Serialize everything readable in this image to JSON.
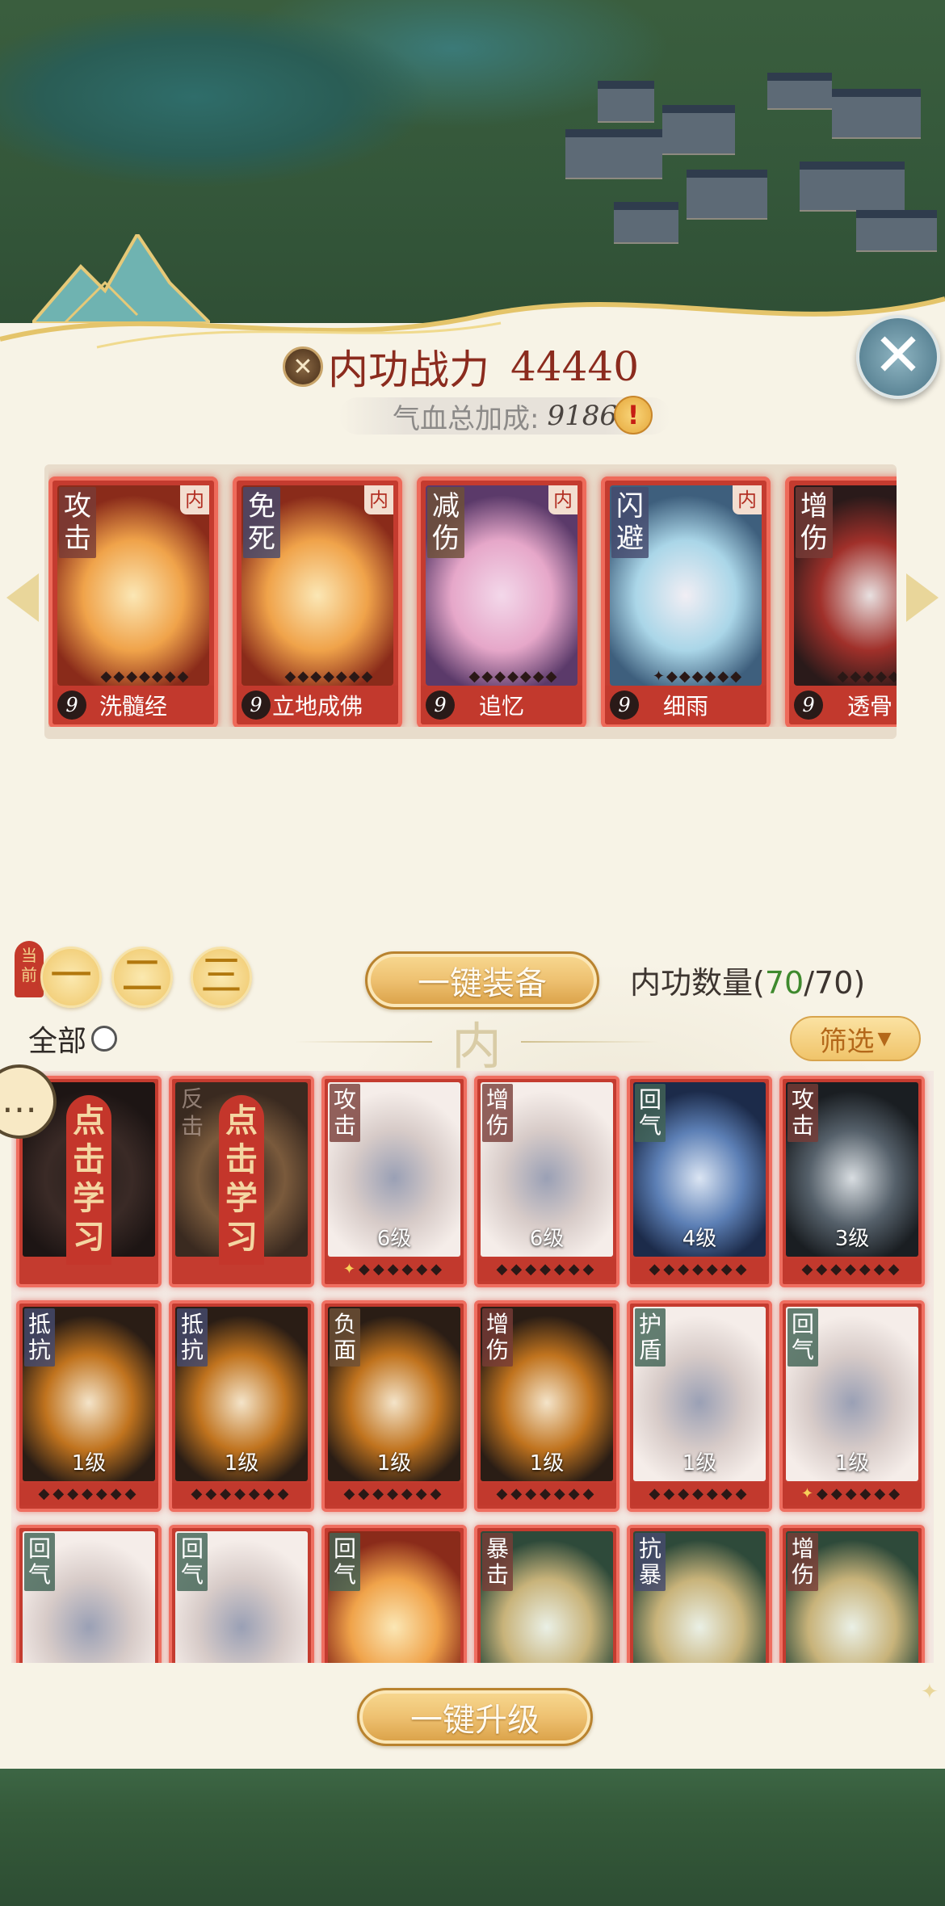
{
  "header": {
    "title_label": "内功战力",
    "power_value": "44440",
    "hp_bonus_label": "气血总加成:",
    "hp_bonus_value": "9186",
    "alert_symbol": "!",
    "close_symbol": "✕"
  },
  "equipped": [
    {
      "tag": "攻击",
      "tag_color": "red",
      "corner": "内",
      "level": "9",
      "name": "洗髓经",
      "stars": "◆◆◆◆◆◆◆",
      "art": [
        "#8a2b1a",
        "#f0a34a",
        "#fbe7b5"
      ]
    },
    {
      "tag": "免死",
      "tag_color": "blue",
      "corner": "内",
      "level": "9",
      "name": "立地成佛",
      "stars": "◆◆◆◆◆◆◆",
      "art": [
        "#8a2b1a",
        "#f0a34a",
        "#fbe7b5"
      ]
    },
    {
      "tag": "减伤",
      "tag_color": "brown",
      "corner": "内",
      "level": "9",
      "name": "追忆",
      "stars": "◆◆◆◆◆◆◆",
      "art": [
        "#5b3a6a",
        "#e6a7c9",
        "#f3d8ea"
      ]
    },
    {
      "tag": "闪避",
      "tag_color": "blue",
      "corner": "内",
      "level": "9",
      "name": "细雨",
      "stars": "✦◆◆◆◆◆◆",
      "art": [
        "#3e5f7d",
        "#aad6e8",
        "#f1eef4"
      ]
    },
    {
      "tag": "增伤",
      "tag_color": "red",
      "corner": "",
      "level": "9",
      "name": "透骨",
      "stars": "◆◆◆◆◆◆◆",
      "art": [
        "#2a1a1a",
        "#a0302a",
        "#e8e0e0"
      ]
    }
  ],
  "presets": {
    "current_badge": "当前",
    "tabs": [
      "一",
      "二",
      "三"
    ],
    "equip_all_label": "一键装备",
    "count_label": "内功数量",
    "count_current": "70",
    "count_max": "70"
  },
  "filter": {
    "all_label": "全部",
    "divider_char": "内",
    "filter_label": "筛选"
  },
  "learn_label": "点击学习",
  "grid": [
    {
      "type": "learn",
      "art": [
        "#1d1514",
        "#3a2a26",
        "#2a201d"
      ]
    },
    {
      "type": "learn",
      "ghost_tag": "反击",
      "art": [
        "#3a2a20",
        "#7a5a3c",
        "#2a201d"
      ]
    },
    {
      "tag": "攻击",
      "tag_color": "red",
      "level": "6级",
      "stars": "✦◆◆◆◆◆◆",
      "gold_first": true,
      "art": [
        "#f5ede9",
        "#d7cbc8",
        "#9aa0b5"
      ]
    },
    {
      "tag": "增伤",
      "tag_color": "red",
      "level": "6级",
      "stars": "◆◆◆◆◆◆◆",
      "art": [
        "#f5ede9",
        "#d7cbc8",
        "#9aa0b5"
      ]
    },
    {
      "tag": "回气",
      "tag_color": "green",
      "level": "4级",
      "stars": "◆◆◆◆◆◆◆",
      "art": [
        "#1c2b4a",
        "#5c7fb5",
        "#dbe5f3"
      ]
    },
    {
      "tag": "攻击",
      "tag_color": "red",
      "level": "3级",
      "stars": "◆◆◆◆◆◆◆",
      "art": [
        "#1a1e22",
        "#55606a",
        "#d8dde1"
      ]
    },
    {
      "tag": "抵抗",
      "tag_color": "blue",
      "level": "1级",
      "stars": "◆◆◆◆◆◆◆",
      "art": [
        "#2a1d15",
        "#c0731e",
        "#f4e4c9"
      ]
    },
    {
      "tag": "抵抗",
      "tag_color": "blue",
      "level": "1级",
      "stars": "◆◆◆◆◆◆◆",
      "art": [
        "#2a1d15",
        "#c0731e",
        "#f4e4c9"
      ]
    },
    {
      "tag": "负面",
      "tag_color": "brown",
      "level": "1级",
      "stars": "◆◆◆◆◆◆◆",
      "art": [
        "#2a1d15",
        "#c0731e",
        "#f4e4c9"
      ]
    },
    {
      "tag": "增伤",
      "tag_color": "red",
      "level": "1级",
      "stars": "◆◆◆◆◆◆◆",
      "art": [
        "#2a1d15",
        "#c0731e",
        "#f4e4c9"
      ]
    },
    {
      "tag": "护盾",
      "tag_color": "green",
      "level": "1级",
      "stars": "◆◆◆◆◆◆◆",
      "art": [
        "#f5ede9",
        "#d7cbc8",
        "#9aa0b5"
      ]
    },
    {
      "tag": "回气",
      "tag_color": "green",
      "level": "1级",
      "stars": "✦◆◆◆◆◆◆",
      "gold_first": true,
      "art": [
        "#f5ede9",
        "#d7cbc8",
        "#9aa0b5"
      ]
    },
    {
      "tag": "回气",
      "tag_color": "green",
      "level": "",
      "stars": "",
      "art": [
        "#f5ede9",
        "#d7cbc8",
        "#9aa0b5"
      ]
    },
    {
      "tag": "回气",
      "tag_color": "green",
      "level": "",
      "stars": "",
      "art": [
        "#f5ede9",
        "#d7cbc8",
        "#9aa0b5"
      ]
    },
    {
      "tag": "回气",
      "tag_color": "green",
      "level": "",
      "stars": "",
      "art": [
        "#8a2b1a",
        "#f0a34a",
        "#fbe7b5"
      ]
    },
    {
      "tag": "暴击",
      "tag_color": "red",
      "level": "",
      "stars": "",
      "art": [
        "#2e4a3a",
        "#c8b37a",
        "#eaf0e6"
      ]
    },
    {
      "tag": "抗暴",
      "tag_color": "blue",
      "level": "",
      "stars": "",
      "art": [
        "#2e4a3a",
        "#c8b37a",
        "#eaf0e6"
      ]
    },
    {
      "tag": "增伤",
      "tag_color": "red",
      "level": "",
      "stars": "",
      "art": [
        "#2e4a3a",
        "#c8b37a",
        "#eaf0e6"
      ]
    }
  ],
  "upgrade_all_label": "一键升级"
}
